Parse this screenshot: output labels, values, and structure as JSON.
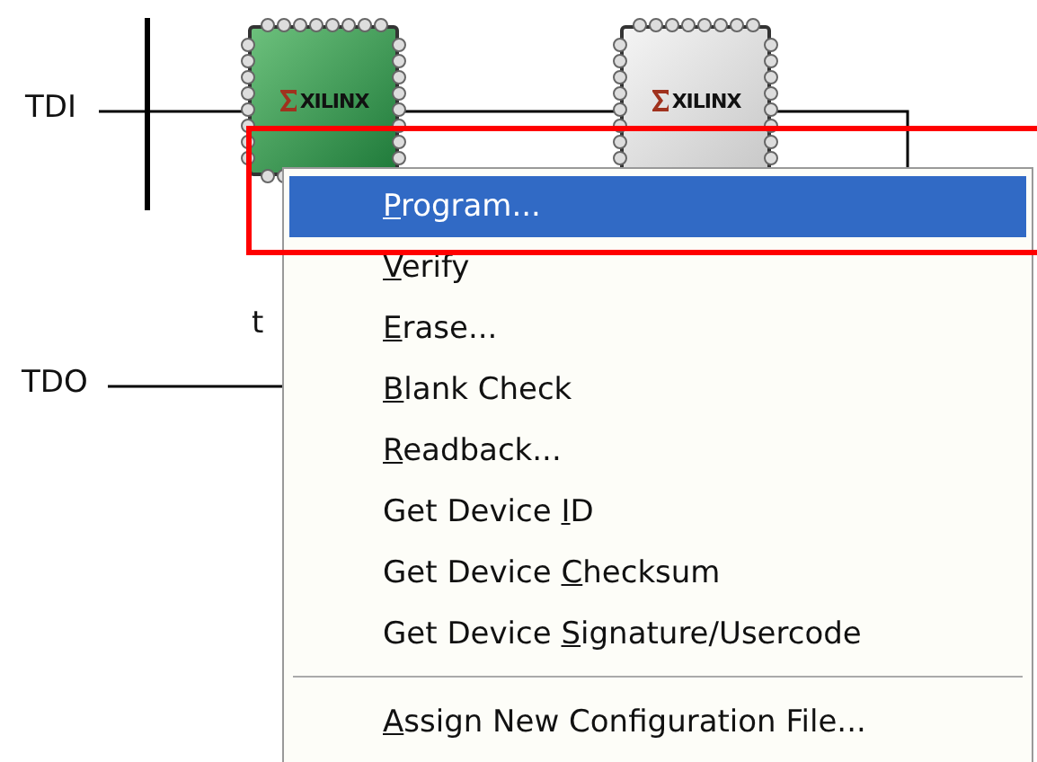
{
  "diagram": {
    "tdi_label": "TDI",
    "tdo_label": "TDO",
    "device_label_fragment": "t",
    "devices": [
      {
        "logo": "XILINX",
        "selected": true
      },
      {
        "logo": "XILINX",
        "selected": false
      }
    ]
  },
  "context_menu": {
    "highlight_frame": true,
    "items": [
      {
        "kind": "item",
        "label": {
          "key": "P",
          "rest": "rogram..."
        },
        "selected": true
      },
      {
        "kind": "item",
        "label": {
          "key": "V",
          "rest": "erify"
        },
        "selected": false
      },
      {
        "kind": "item",
        "label": {
          "key": "E",
          "rest": "rase..."
        },
        "selected": false
      },
      {
        "kind": "item",
        "label": {
          "key": "B",
          "rest": "lank Check"
        },
        "selected": false
      },
      {
        "kind": "item",
        "label": {
          "key": "R",
          "rest": "eadback..."
        },
        "selected": false
      },
      {
        "kind": "item",
        "label": {
          "prefix": "Get Device ",
          "key": "I",
          "rest": "D"
        },
        "selected": false
      },
      {
        "kind": "item",
        "label": {
          "prefix": "Get Device ",
          "key": "C",
          "rest": "hecksum"
        },
        "selected": false
      },
      {
        "kind": "item",
        "label": {
          "prefix": "Get Device ",
          "key": "S",
          "rest": "ignature/Usercode"
        },
        "selected": false
      },
      {
        "kind": "separator"
      },
      {
        "kind": "item",
        "label": {
          "key": "A",
          "rest": "ssign New Configuration File..."
        },
        "selected": false
      }
    ]
  }
}
